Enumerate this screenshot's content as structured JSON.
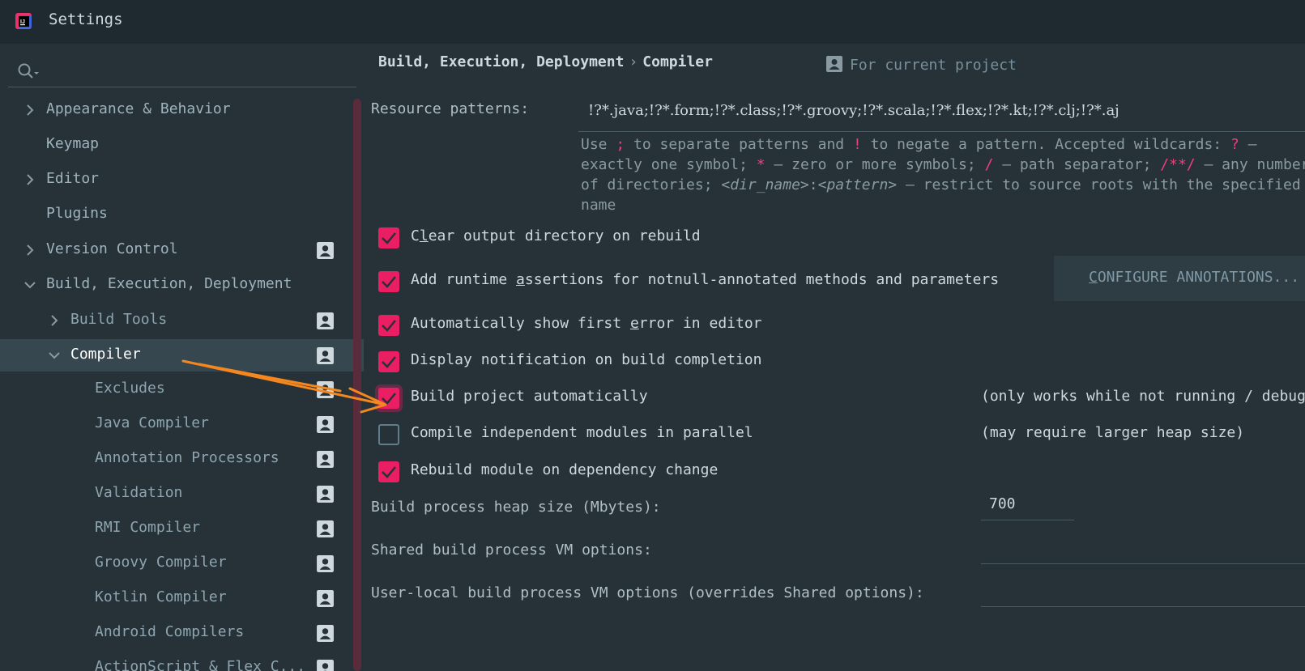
{
  "window": {
    "title": "Settings"
  },
  "sidebar": {
    "search_placeholder": "",
    "items": [
      {
        "label": "Appearance & Behavior",
        "expander": "collapsed",
        "project_icon": false
      },
      {
        "label": "Keymap",
        "expander": "none",
        "project_icon": false
      },
      {
        "label": "Editor",
        "expander": "collapsed",
        "project_icon": false
      },
      {
        "label": "Plugins",
        "expander": "none",
        "project_icon": false
      },
      {
        "label": "Version Control",
        "expander": "collapsed",
        "project_icon": true
      },
      {
        "label": "Build, Execution, Deployment",
        "expander": "expanded",
        "project_icon": false
      },
      {
        "label": "Build Tools",
        "expander": "collapsed",
        "project_icon": true
      },
      {
        "label": "Compiler",
        "expander": "expanded",
        "project_icon": true,
        "selected": true
      },
      {
        "label": "Excludes",
        "expander": "none",
        "project_icon": true
      },
      {
        "label": "Java Compiler",
        "expander": "none",
        "project_icon": true
      },
      {
        "label": "Annotation Processors",
        "expander": "none",
        "project_icon": true
      },
      {
        "label": "Validation",
        "expander": "none",
        "project_icon": true
      },
      {
        "label": "RMI Compiler",
        "expander": "none",
        "project_icon": true
      },
      {
        "label": "Groovy Compiler",
        "expander": "none",
        "project_icon": true
      },
      {
        "label": "Kotlin Compiler",
        "expander": "none",
        "project_icon": true
      },
      {
        "label": "Android Compilers",
        "expander": "none",
        "project_icon": true
      },
      {
        "label": "ActionScript & Flex C...",
        "expander": "none",
        "project_icon": true
      }
    ]
  },
  "header": {
    "breadcrumb": [
      "Build, Execution, Deployment",
      "Compiler"
    ],
    "breadcrumb_separator": "›",
    "scope_label": "For current project"
  },
  "resource_patterns": {
    "label": "Resource patterns:",
    "value": "!?*.java;!?*.form;!?*.class;!?*.groovy;!?*.scala;!?*.flex;!?*.kt;!?*.clj;!?*.aj",
    "help": {
      "l1_a": "Use ",
      "l1_k1": ";",
      "l1_b": " to separate patterns and ",
      "l1_k2": "!",
      "l1_c": " to negate a pattern. Accepted wildcards: ",
      "l1_k3": "?",
      "l1_d": " —",
      "l2_a": "exactly one symbol; ",
      "l2_k1": "*",
      "l2_b": " — zero or more symbols; ",
      "l2_k2": "/",
      "l2_c": " — path separator; ",
      "l2_k3": "/**/",
      "l2_d": " — any number",
      "l3_a": "of directories; ",
      "l3_i1": "<dir_name>",
      "l3_b": ":",
      "l3_i2": "<pattern>",
      "l3_c": " — restrict to source roots with the specified",
      "l4": "name"
    }
  },
  "options": [
    {
      "label_pre": "C",
      "mnemonic": "l",
      "label_post": "ear output directory on rebuild",
      "checked": true
    },
    {
      "label_pre": "Add runtime ",
      "mnemonic": "a",
      "label_post": "ssertions for notnull-annotated methods and parameters",
      "checked": true
    },
    {
      "label_pre": "Automatically show first ",
      "mnemonic": "e",
      "label_post": "rror in editor",
      "checked": true
    },
    {
      "label_pre": "Display notification on build completion",
      "mnemonic": "",
      "label_post": "",
      "checked": true
    },
    {
      "label_pre": "Build project automatically",
      "mnemonic": "",
      "label_post": "",
      "checked": true,
      "focused": true,
      "note": "(only works while not running / debugging)"
    },
    {
      "label_pre": "Compile independent modules in parallel",
      "mnemonic": "",
      "label_post": "",
      "checked": false,
      "note": "(may require larger heap size)"
    },
    {
      "label_pre": "Rebuild module on dependency change",
      "mnemonic": "",
      "label_post": "",
      "checked": true
    }
  ],
  "configure_button": {
    "mnemonic": "C",
    "label_rest": "ONFIGURE ANNOTATIONS..."
  },
  "heap": {
    "label": "Build process heap size (Mbytes):",
    "value": "700"
  },
  "shared_vm": {
    "label": "Shared build process VM options:",
    "value": ""
  },
  "user_vm": {
    "label": "User-local build process VM options (overrides Shared options):",
    "value": ""
  },
  "colors": {
    "accent": "#e91e63",
    "annotation_arrow": "#f5871f",
    "background": "#263238"
  }
}
